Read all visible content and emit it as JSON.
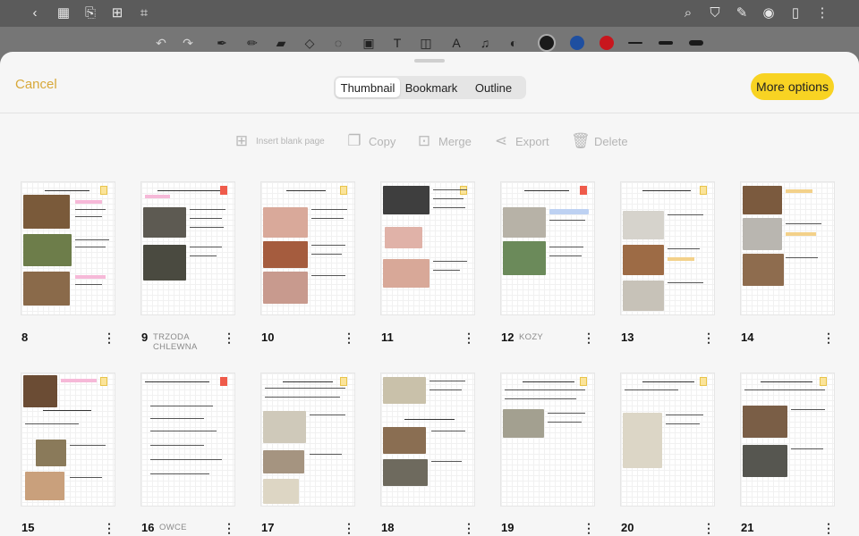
{
  "topbar": {
    "icons": [
      "back-icon",
      "grid-icon",
      "bookmark-icon",
      "add-page-icon",
      "crop-icon",
      "search-icon",
      "shirt-icon",
      "pen-edit-icon",
      "eye-icon",
      "reader-icon",
      "more-vertical-icon"
    ]
  },
  "toolbar": {
    "tools": [
      "undo-icon",
      "redo-icon",
      "pen-icon",
      "brush-icon",
      "highlighter-icon",
      "eraser-icon",
      "lasso-icon",
      "image-icon",
      "text-icon",
      "shape-icon",
      "ocr-icon",
      "mic-icon",
      "sticker-icon"
    ],
    "colors": [
      "#1a1a1a",
      "#1f4fa0",
      "#c8161d"
    ]
  },
  "dialog": {
    "cancel_label": "Cancel",
    "tabs": [
      "Thumbnail",
      "Bookmark",
      "Outline"
    ],
    "active_tab": "Thumbnail",
    "more_label": "More options",
    "accent": "#f8d323"
  },
  "actions": {
    "insert": "Insert blank page",
    "copy": "Copy",
    "merge": "Merge",
    "export": "Export",
    "delete": "Delete"
  },
  "pages": [
    {
      "number": "8",
      "label": ""
    },
    {
      "number": "9",
      "label": "TRZODA CHLEWNA"
    },
    {
      "number": "10",
      "label": ""
    },
    {
      "number": "11",
      "label": ""
    },
    {
      "number": "12",
      "label": "KOZY"
    },
    {
      "number": "13",
      "label": ""
    },
    {
      "number": "14",
      "label": ""
    },
    {
      "number": "15",
      "label": ""
    },
    {
      "number": "16",
      "label": "OWCE"
    },
    {
      "number": "17",
      "label": ""
    },
    {
      "number": "18",
      "label": ""
    },
    {
      "number": "19",
      "label": ""
    },
    {
      "number": "20",
      "label": ""
    },
    {
      "number": "21",
      "label": ""
    }
  ]
}
